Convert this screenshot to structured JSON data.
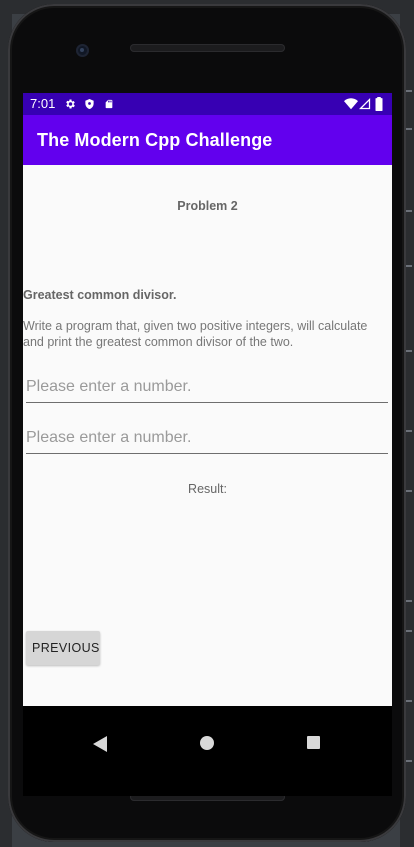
{
  "status_bar": {
    "time": "7:01",
    "icons": [
      "settings-icon",
      "shield-icon",
      "sd-card-icon",
      "wifi-icon",
      "signal-icon",
      "battery-icon"
    ]
  },
  "app_bar": {
    "title": "The Modern Cpp Challenge"
  },
  "content": {
    "problem_title": "Problem 2",
    "heading": "Greatest common divisor.",
    "description": "Write a program that, given two positive integers, will calculate and print the greatest common divisor of the two.",
    "input1": {
      "placeholder": "Please enter a number.",
      "value": ""
    },
    "input2": {
      "placeholder": "Please enter a number.",
      "value": ""
    },
    "result_label": "Result:",
    "previous_button": "PREVIOUS"
  },
  "nav_bar": {
    "icons": [
      "back-icon",
      "home-icon",
      "recents-icon"
    ]
  },
  "colors": {
    "status_bar": "#3700b3",
    "app_bar": "#6200ee",
    "content_bg": "#fafafa",
    "button_bg": "#d6d6d6"
  }
}
